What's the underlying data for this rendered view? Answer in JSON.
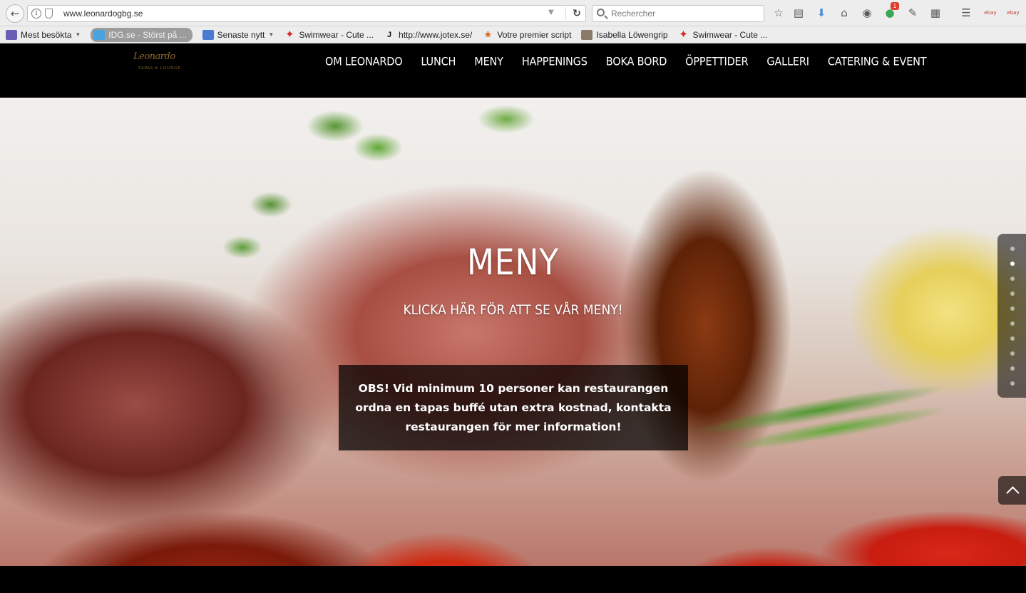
{
  "browser": {
    "url": "www.leonardogbg.se",
    "search_placeholder": "Rechercher",
    "notification_count": "1",
    "icons": [
      "back-icon",
      "info-icon",
      "shield-icon",
      "reload-icon",
      "search-icon",
      "bookmark-star-icon",
      "reader-list-icon",
      "download-icon",
      "home-icon",
      "pocket-icon",
      "extension-icon",
      "eyedropper-icon",
      "screen-icon",
      "menu-icon",
      "ebay-icon"
    ],
    "ebay_label": "ebay"
  },
  "bookmarks": [
    {
      "label": "Mest besökta",
      "icon": "folder-icon",
      "dropdown": true
    },
    {
      "label": "IDG.se - Störst på ...",
      "icon": "idg-icon",
      "highlight": true
    },
    {
      "label": "Senaste nytt",
      "icon": "rss-icon",
      "dropdown": true
    },
    {
      "label": "Swimwear - Cute ...",
      "icon": "star-red-icon"
    },
    {
      "label": "http://www.jotex.se/",
      "icon": "j-icon"
    },
    {
      "label": "Votre premier script",
      "icon": "script-icon"
    },
    {
      "label": "Isabella Löwengrip",
      "icon": "person-icon"
    },
    {
      "label": "Swimwear - Cute ...",
      "icon": "star-red-icon"
    }
  ],
  "site": {
    "logo_script": "Leonardo",
    "logo_sub": "TAPAS & LOUNGE",
    "nav": [
      "OM LEONARDO",
      "LUNCH",
      "MENY",
      "HAPPENINGS",
      "BOKA BORD",
      "ÖPPETTIDER",
      "GALLERI",
      "CATERING & EVENT"
    ]
  },
  "hero": {
    "title": "MENY",
    "subtitle": "KLICKA HÄR FÖR ATT SE VÅR MENY!",
    "notice": "OBS! Vid minimum 10 personer kan restaurangen ordna en tapas buffé utan extra kostnad, kontakta restaurangen för mer information!"
  },
  "slide_nav": {
    "count": 10,
    "active_index": 1
  },
  "colors": {
    "header_bg": "#000000",
    "logo_gold": "#8b6a2b",
    "nav_text": "#ffffff",
    "notice_bg": "rgba(0,0,0,0.72)"
  }
}
